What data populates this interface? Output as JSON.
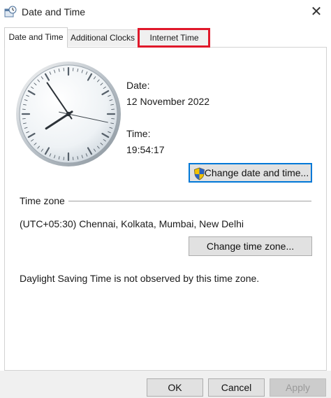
{
  "window": {
    "title": "Date and Time",
    "close_glyph": "✕",
    "icon": "date-time-control-panel-icon"
  },
  "tabs": [
    {
      "label": "Date and Time",
      "active": true
    },
    {
      "label": "Additional Clocks",
      "active": false
    },
    {
      "label": "Internet Time",
      "active": false,
      "highlighted": true
    }
  ],
  "highlight_color": "#e0182a",
  "date_section": {
    "date_label": "Date:",
    "date_value": "12 November 2022",
    "time_label": "Time:",
    "time_value": "19:54:17",
    "change_button": "Change date and time..."
  },
  "timezone_section": {
    "heading": "Time zone",
    "value": "(UTC+05:30) Chennai, Kolkata, Mumbai, New Delhi",
    "change_button": "Change time zone...",
    "dst_note": "Daylight Saving Time is not observed by this time zone."
  },
  "footer": {
    "ok": "OK",
    "cancel": "Cancel",
    "apply": "Apply"
  }
}
